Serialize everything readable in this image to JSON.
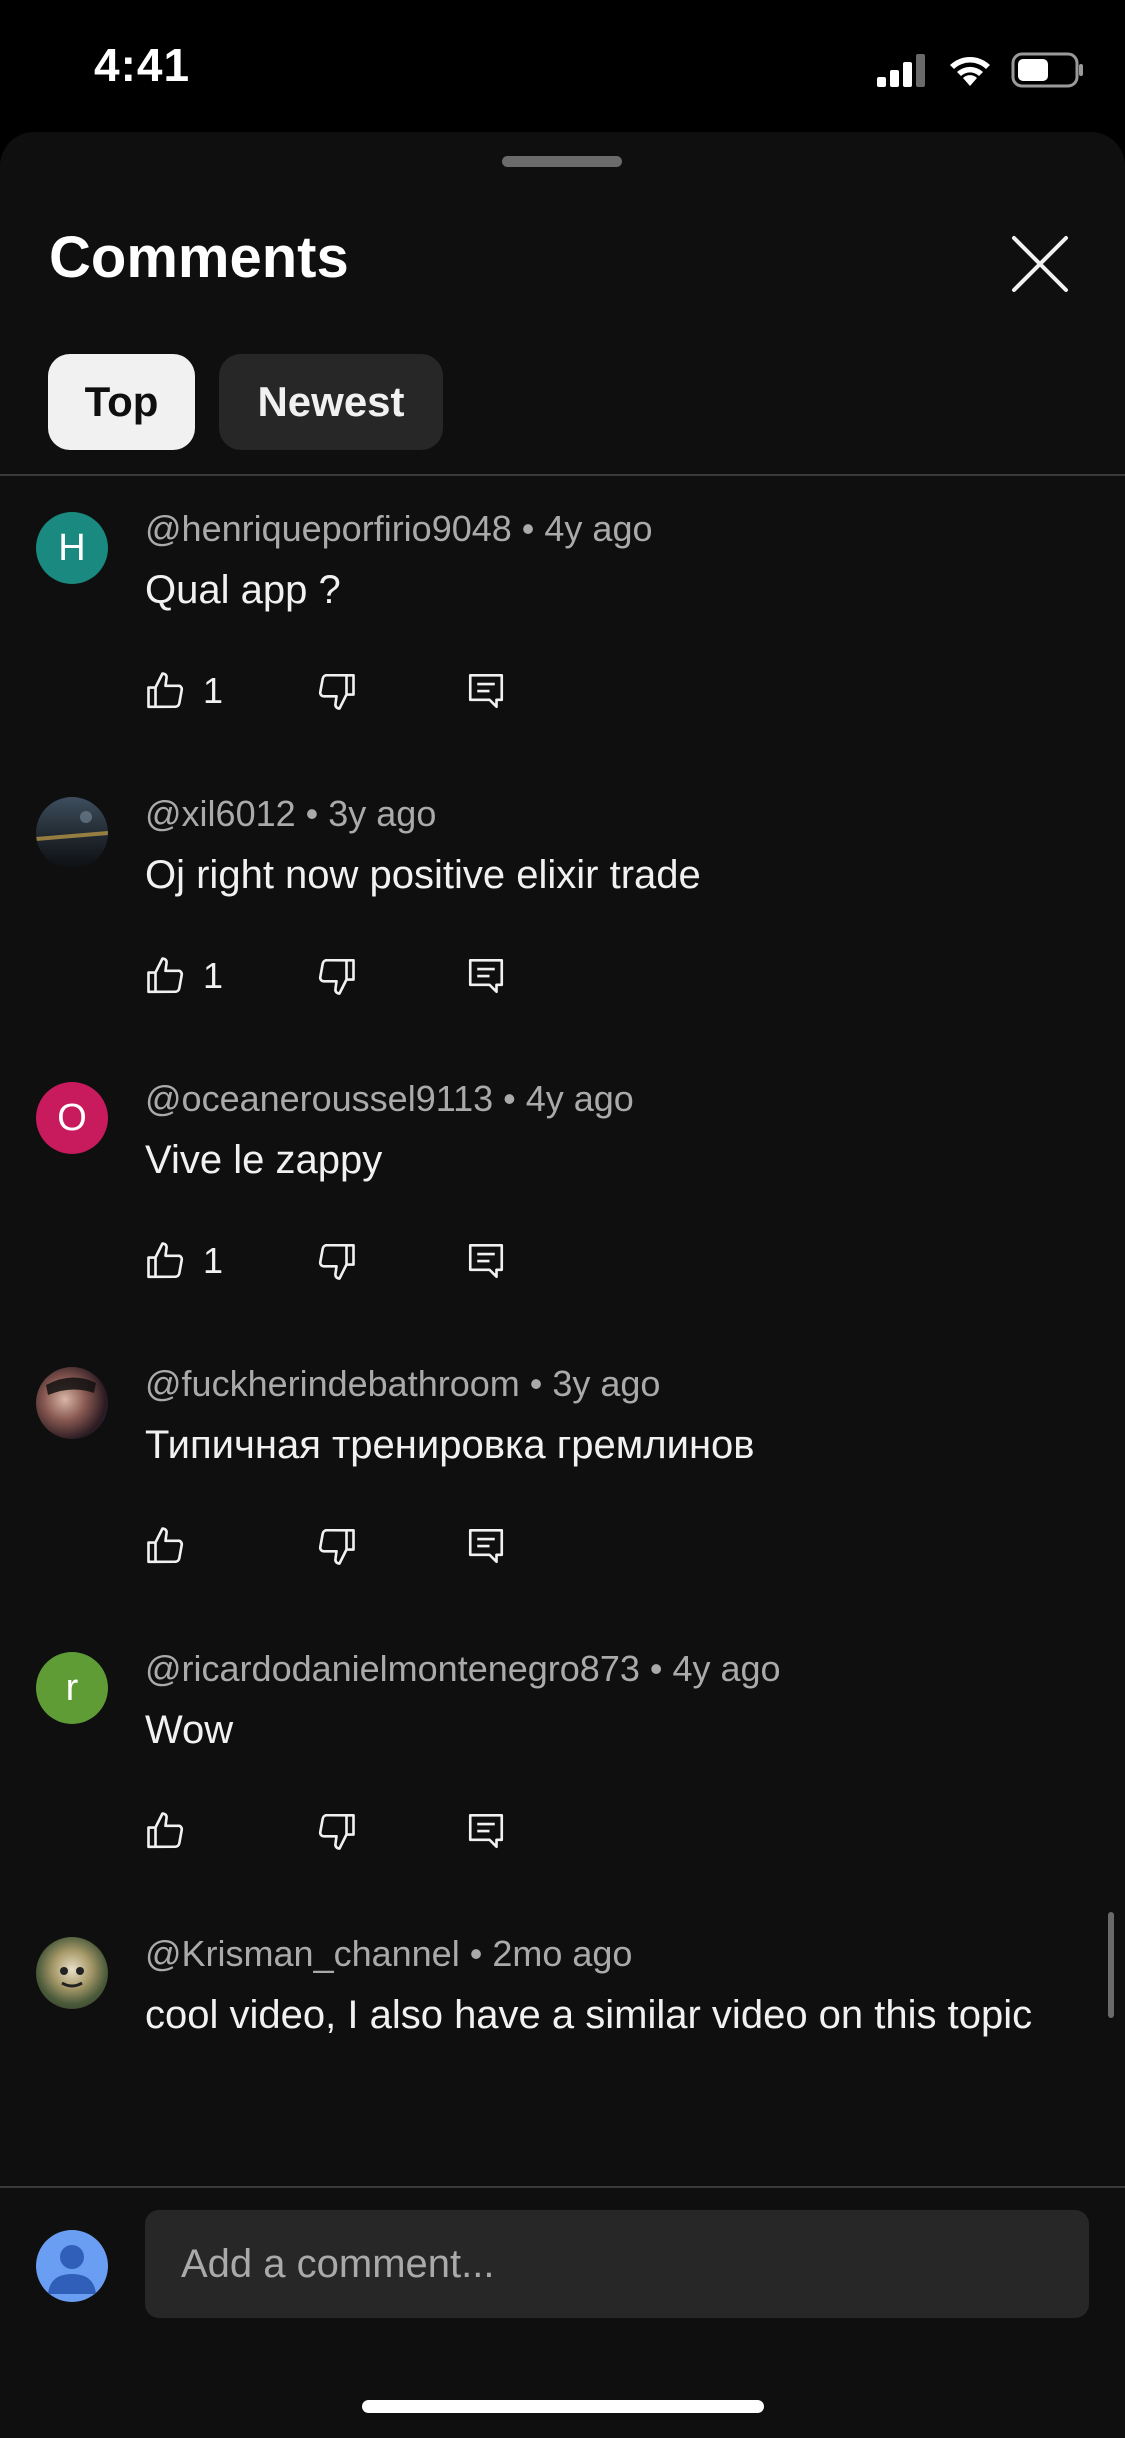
{
  "status_bar": {
    "time": "4:41"
  },
  "header": {
    "title": "Comments"
  },
  "tabs": [
    {
      "label": "Top",
      "selected": true
    },
    {
      "label": "Newest",
      "selected": false
    }
  ],
  "comments": [
    {
      "author": "@henriqueporfirio9048",
      "age": "4y ago",
      "text": "Qual app ?",
      "likes": "1",
      "avatar_letter": "H",
      "avatar_color": "#1a8a80"
    },
    {
      "author": "@xil6012",
      "age": "3y ago",
      "text": "Oj right now positive elixir trade",
      "likes": "1",
      "avatar_letter": "",
      "avatar_color": "#2d3d4a"
    },
    {
      "author": "@oceaneroussel9113",
      "age": "4y ago",
      "text": "Vive le zappy",
      "likes": "1",
      "avatar_letter": "O",
      "avatar_color": "#c81b5e"
    },
    {
      "author": "@fuckherindebathroom",
      "age": "3y ago",
      "text": "Типичная тренировка гремлинов",
      "likes": "",
      "avatar_letter": "",
      "avatar_color": "#3a2a36"
    },
    {
      "author": "@ricardodanielmontenegro873",
      "age": "4y ago",
      "text": "Wow",
      "likes": "",
      "avatar_letter": "r",
      "avatar_color": "#5f9c36"
    },
    {
      "author": "@Krisman_channel",
      "age": "2mo ago",
      "text": "cool video, I also have a similar video on this topic",
      "likes": "",
      "avatar_letter": "",
      "avatar_color": "#7d7a5a"
    }
  ],
  "compose": {
    "placeholder": "Add a comment..."
  },
  "icons": {
    "like": "thumbs-up-icon",
    "dislike": "thumbs-down-icon",
    "reply": "reply-icon",
    "close": "close-icon"
  },
  "colors": {
    "sheet_bg": "#0f0f0f",
    "chip_selected_bg": "#f1f1f1",
    "chip_bg": "#272727",
    "meta_text": "#aaaaaa"
  }
}
